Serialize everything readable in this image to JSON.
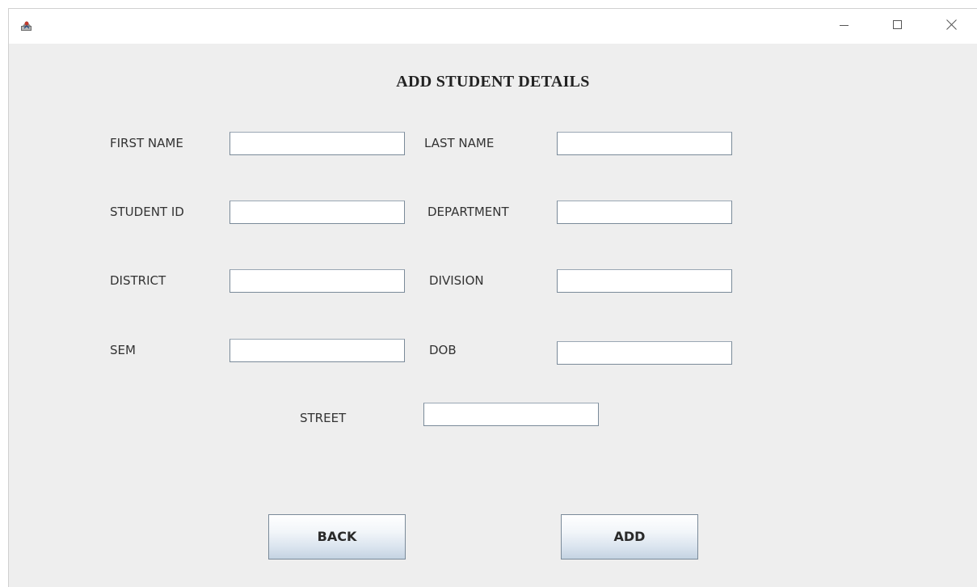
{
  "window": {
    "title": "",
    "app_icon": "java-app-icon",
    "controls": {
      "minimize_icon": "minimize-icon",
      "maximize_icon": "maximize-icon",
      "close_icon": "close-icon"
    }
  },
  "form": {
    "title": "ADD STUDENT DETAILS",
    "fields": {
      "first_name": {
        "label": "FIRST NAME",
        "value": ""
      },
      "last_name": {
        "label": "LAST NAME",
        "value": ""
      },
      "student_id": {
        "label": "STUDENT ID",
        "value": ""
      },
      "department": {
        "label": "DEPARTMENT",
        "value": ""
      },
      "district": {
        "label": "DISTRICT",
        "value": ""
      },
      "division": {
        "label": "DIVISION",
        "value": ""
      },
      "sem": {
        "label": "SEM",
        "value": ""
      },
      "dob": {
        "label": "DOB",
        "value": ""
      },
      "street": {
        "label": "STREET",
        "value": ""
      }
    },
    "buttons": {
      "back": "BACK",
      "add": "ADD"
    }
  }
}
